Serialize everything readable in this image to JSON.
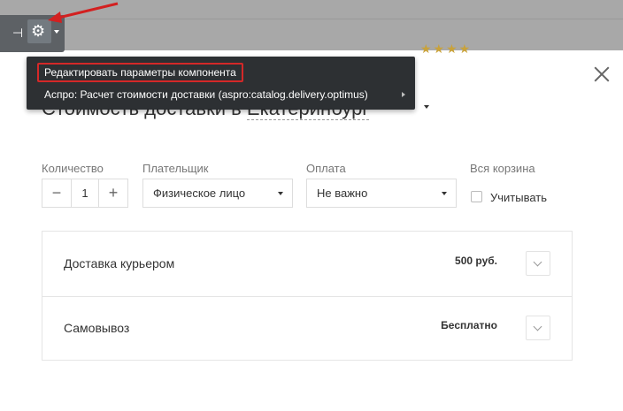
{
  "admin_panel": {
    "pin_icon": "pin-icon",
    "settings_icon": "gear-icon",
    "dropdown_icon": "chevron-down-icon"
  },
  "context_menu": {
    "items": [
      {
        "label": "Редактировать параметры компонента",
        "highlighted": true
      },
      {
        "label": "Аспро: Расчет стоимости доставки (aspro:catalog.delivery.optimus)",
        "has_submenu": true
      }
    ]
  },
  "modal": {
    "title": "Стоимость доставки в",
    "city": "Екатеринбург",
    "close_icon": "close-icon"
  },
  "form": {
    "quantity": {
      "label": "Количество",
      "value": "1",
      "minus": "−",
      "plus": "+"
    },
    "payer": {
      "label": "Плательщик",
      "value": "Физическое лицо"
    },
    "payment": {
      "label": "Оплата",
      "value": "Не важно"
    },
    "cart": {
      "label": "Вся корзина",
      "checkbox_label": "Учитывать",
      "checked": false
    }
  },
  "delivery_options": [
    {
      "name": "Доставка курьером",
      "price": "500 руб."
    },
    {
      "name": "Самовывоз",
      "price": "Бесплатно"
    }
  ],
  "colors": {
    "highlight_border": "#d32020",
    "arrow": "#d32020",
    "menu_bg": "#25282b"
  }
}
